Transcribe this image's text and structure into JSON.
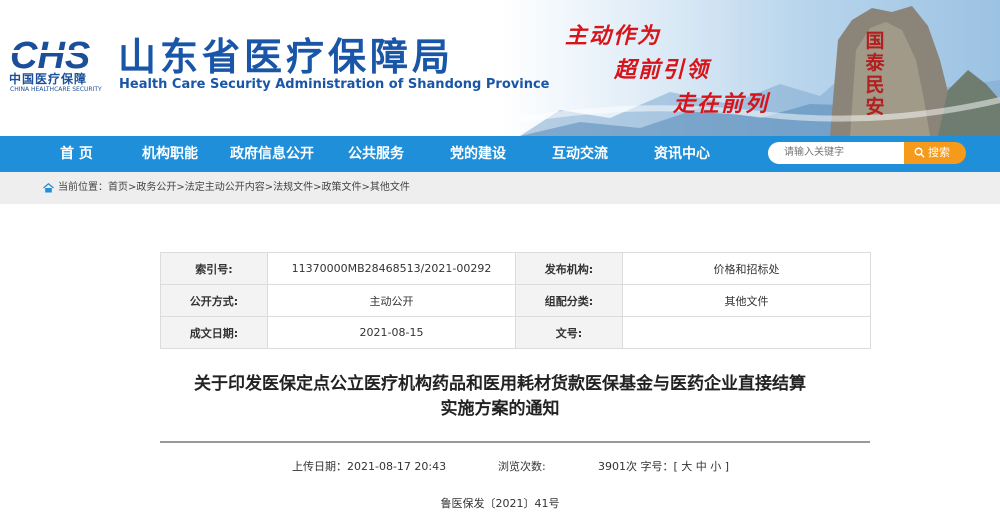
{
  "header": {
    "logo_cn": "中国医疗保障",
    "logo_en": "CHINA HEALTHCARE SECURITY",
    "site_title": "山东省医疗保障局",
    "site_subtitle": "Health Care Security Administration of Shandong Province",
    "slogans": [
      "主动作为",
      "超前引领",
      "走在前列"
    ],
    "rock_text": "国泰民安"
  },
  "nav": {
    "items": [
      "首 页",
      "机构职能",
      "政府信息公开",
      "公共服务",
      "党的建设",
      "互动交流",
      "资讯中心"
    ],
    "search_placeholder": "请输入关键字",
    "search_button": "搜索"
  },
  "breadcrumb": {
    "text": "当前位置：首页>政务公开>法定主动公开内容>法规文件>政策文件>其他文件"
  },
  "meta": {
    "index_label": "索引号:",
    "index_value": "11370000MB28468513/2021-00292",
    "publisher_label": "发布机构:",
    "publisher_value": "价格和招标处",
    "open_label": "公开方式:",
    "open_value": "主动公开",
    "category_label": "组配分类:",
    "category_value": "其他文件",
    "date_label": "成文日期:",
    "date_value": "2021-08-15",
    "docno_label": "文号:",
    "docno_value": ""
  },
  "document": {
    "title_line1": "关于印发医保定点公立医疗机构药品和医用耗材货款医保基金与医药企业直接结算",
    "title_line2": "实施方案的通知",
    "upload": "上传日期：2021-08-17 20:43",
    "views_label": "浏览次数:",
    "views_value": "3901次 字号：[ 大 中 小 ]",
    "doc_number": "鲁医保发〔2021〕41号"
  },
  "colors": {
    "nav_bg": "#1f8fd9",
    "brand_blue": "#1a56a8",
    "slogan_red": "#d8141b",
    "search_orange": "#f59a1b"
  }
}
